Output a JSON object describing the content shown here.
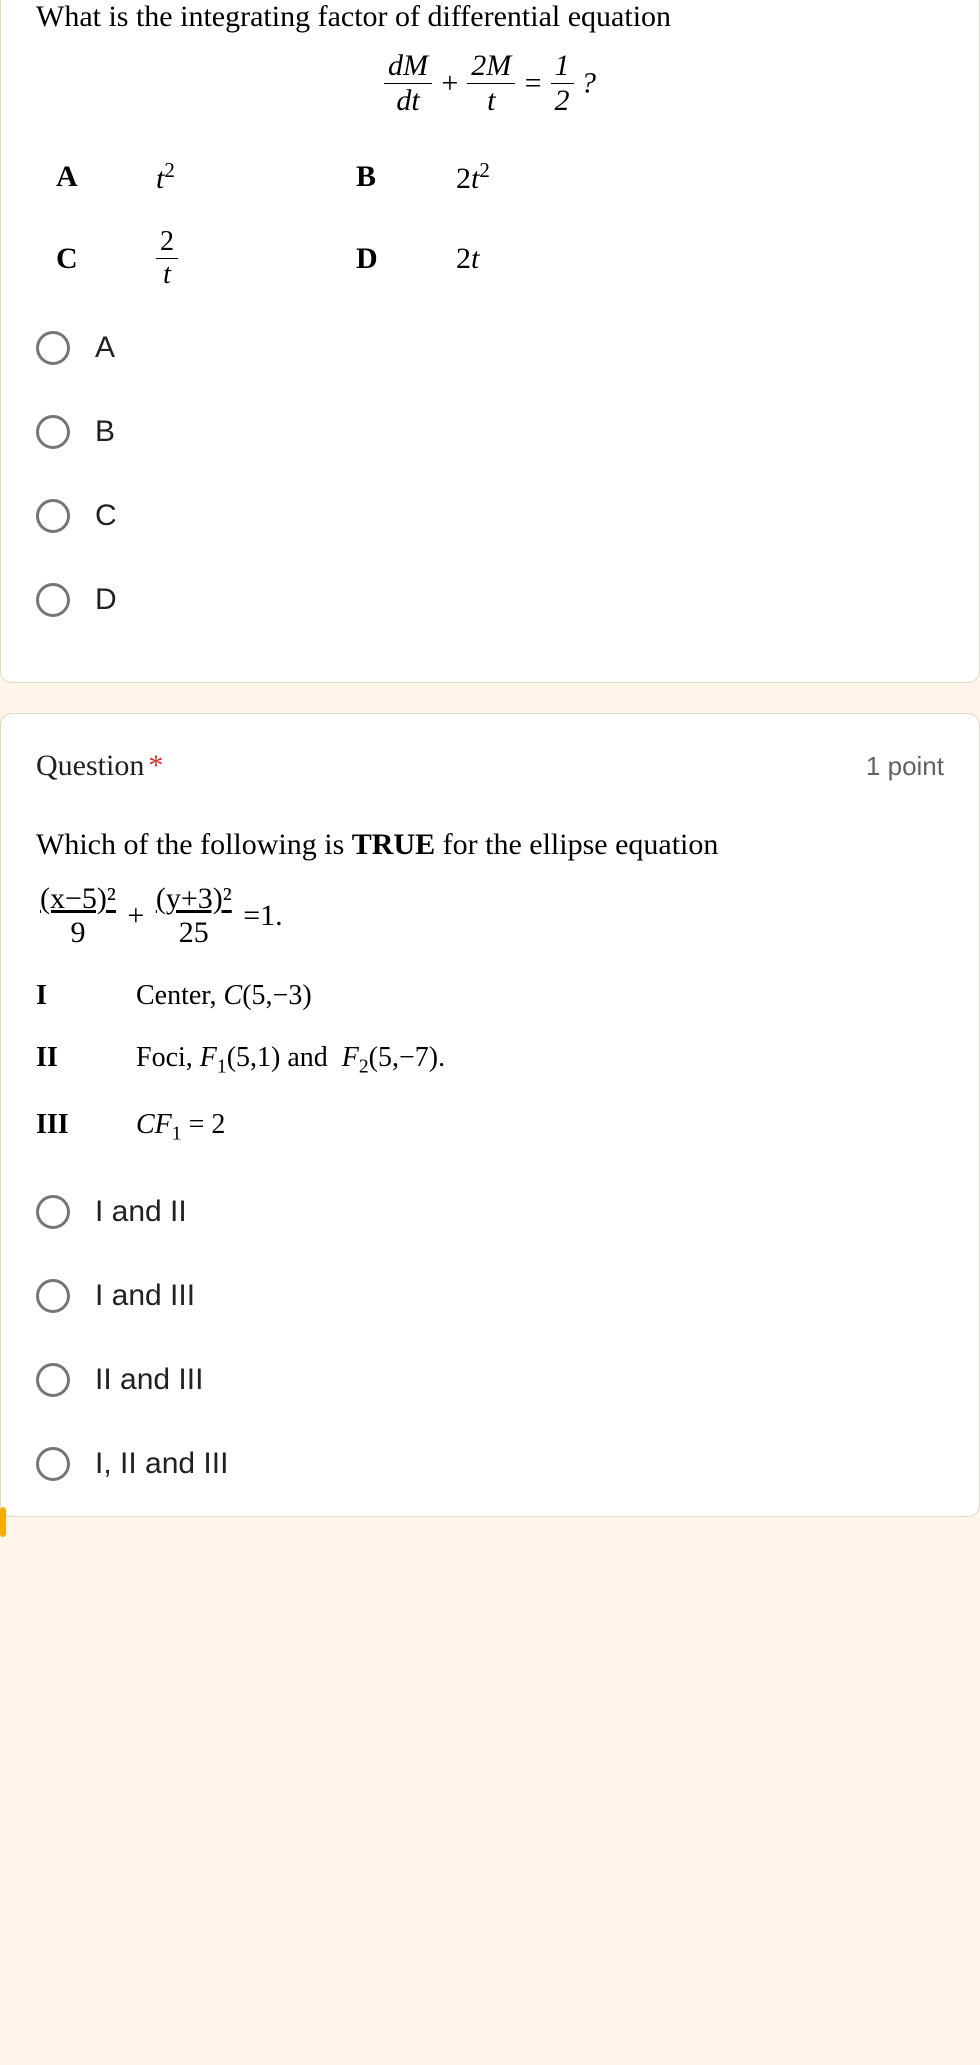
{
  "q1": {
    "question_text": "What is the integrating factor of differential equation",
    "answer_A_label": "A",
    "answer_A_value": "t²",
    "answer_B_label": "B",
    "answer_B_value": "2t²",
    "answer_C_label": "C",
    "answer_C_value_num": "2",
    "answer_C_value_den": "t",
    "answer_D_label": "D",
    "answer_D_value": "2t",
    "options": {
      "a": "A",
      "b": "B",
      "c": "C",
      "d": "D"
    }
  },
  "q2": {
    "title": "Question",
    "required_marker": "*",
    "points": "1 point",
    "question_text": "Which of the following is ",
    "question_bold": "TRUE",
    "question_text2": " for the ellipse equation",
    "eq_num1": "(x−5)²",
    "eq_den1": "9",
    "eq_num2": "(y+3)²",
    "eq_den2": "25",
    "eq_result": "=1.",
    "statements": {
      "I_label": "I",
      "I_text": "Center, C(5,−3)",
      "II_label": "II",
      "II_text": "Foci, F₁(5,1) and  F₂(5,−7).",
      "III_label": "III",
      "III_text": "CF₁ = 2"
    },
    "options": {
      "a": "I and II",
      "b": "I and III",
      "c": "II and III",
      "d": "I, II and III"
    }
  }
}
